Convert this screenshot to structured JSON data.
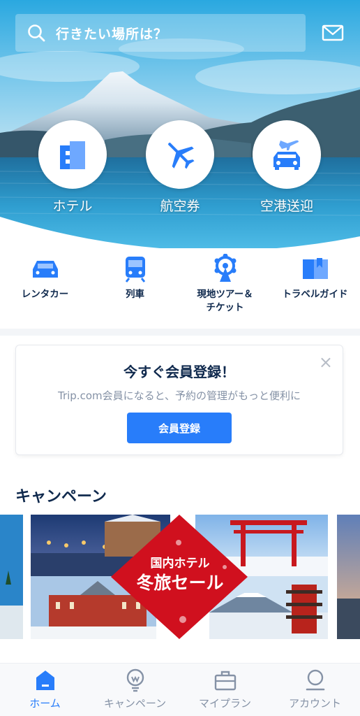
{
  "search": {
    "placeholder": "行きたい場所は？"
  },
  "hero_buttons": [
    {
      "label": "ホテル",
      "icon": "hotel-icon"
    },
    {
      "label": "航空券",
      "icon": "airplane-icon"
    },
    {
      "label": "空港送迎",
      "icon": "airport-transfer-icon"
    }
  ],
  "quick_nav": [
    {
      "label": "レンタカー",
      "icon": "car-icon"
    },
    {
      "label": "列車",
      "icon": "train-icon"
    },
    {
      "label": "現地ツアー＆\nチケット",
      "label_line1": "現地ツアー＆",
      "label_line2": "チケット",
      "icon": "ferris-wheel-icon"
    },
    {
      "label": "トラベルガイド",
      "icon": "guidebook-icon"
    }
  ],
  "member_card": {
    "title": "今すぐ会員登録！",
    "description": "Trip.com会員になると、予約の管理がもっと便利に",
    "button_label": "会員登録",
    "close_symbol": "×"
  },
  "campaign": {
    "section_title": "キャンペーン",
    "banner_line1": "国内ホテル",
    "banner_line2": "冬旅セール"
  },
  "tab_bar": [
    {
      "label": "ホーム",
      "icon": "home-icon",
      "active": true
    },
    {
      "label": "キャンペーン",
      "icon": "lightbulb-icon",
      "active": false
    },
    {
      "label": "マイプラン",
      "icon": "briefcase-icon",
      "active": false
    },
    {
      "label": "アカウント",
      "icon": "account-icon",
      "active": false
    }
  ],
  "colors": {
    "accent": "#287dfa",
    "text": "#0f294d",
    "muted": "#8592a6",
    "banner_red": "#d0101e"
  }
}
